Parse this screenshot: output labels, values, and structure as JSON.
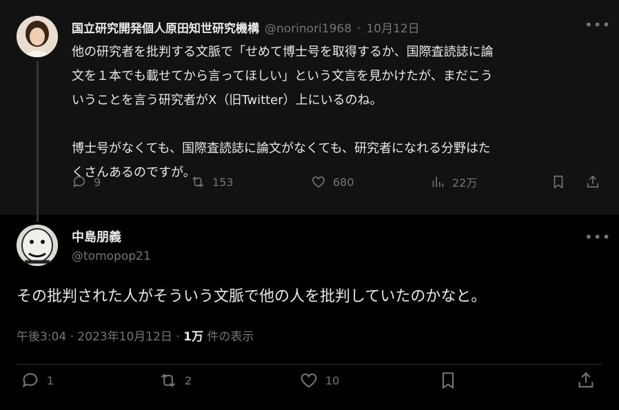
{
  "parent_tweet": {
    "author_name": "国立研究開発個人原田知世研究機構",
    "handle": "@norinori1968",
    "separator": "·",
    "date": "10月12日",
    "more_icon": "more-horizontal-icon",
    "text_lines": [
      "他の研究者を批判する文脈で「せめて博士号を取得するか、国際査読誌に論",
      "文を１本でも載せてから言ってほしい」という文言を見かけたが、まだこう",
      "いうことを言う研究者がX（旧Twitter）上にいるのね。",
      "博士号がなくても、国際査読誌に論文がなくても、研究者になれる分野はた",
      "くさんあるのですが。"
    ],
    "stats": {
      "replies": "9",
      "reposts": "153",
      "likes": "680",
      "views": "22万"
    }
  },
  "main_tweet": {
    "author_name": "中島朋義",
    "handle": "@tomopop21",
    "more_icon": "more-horizontal-icon",
    "text": "その批判された人がそういう文脈で他の人を批判していたのかなと。",
    "time": "午後3:04",
    "separator": "·",
    "date": "2023年10月12日",
    "views_count": "1万",
    "views_label": "件の表示",
    "stats": {
      "replies": "1",
      "reposts": "2",
      "likes": "10"
    }
  },
  "colors": {
    "background": "#000000",
    "parent_background": "#121212",
    "text": "#e7e9ea",
    "muted": "#71767b"
  }
}
